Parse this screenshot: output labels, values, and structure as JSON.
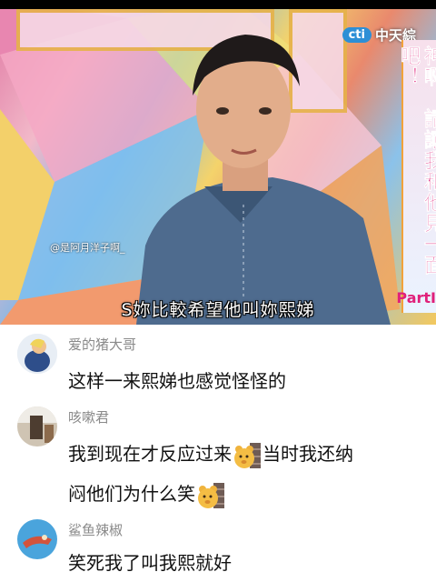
{
  "video": {
    "channel_logo_badge": "cti",
    "channel_logo_text": "中天綜",
    "side_banner": "神啊！請讓我和他見一面吧！",
    "part_label": "PartI",
    "watermark": "@是阿月洋子啊_",
    "subtitle": "S妳比較希望他叫妳熙娣"
  },
  "comments": [
    {
      "username": "爱的猪大哥",
      "lines": [
        "这样一来熙娣也感觉怪怪的"
      ]
    },
    {
      "username": "咳嗽君",
      "line1_before": "我到现在才反应过来",
      "line1_after": "当时我还纳",
      "line2": "闷他们为什么笑",
      "emoji": "doge-bear-emoji"
    },
    {
      "username": "鲨鱼辣椒",
      "lines": [
        "笑死我了叫我熙就好"
      ]
    }
  ],
  "colors": {
    "username_gray": "#8a8a8a",
    "comment_text": "#111111",
    "banner_pink": "#e0207a",
    "logo_blue": "#2d8fd6"
  }
}
